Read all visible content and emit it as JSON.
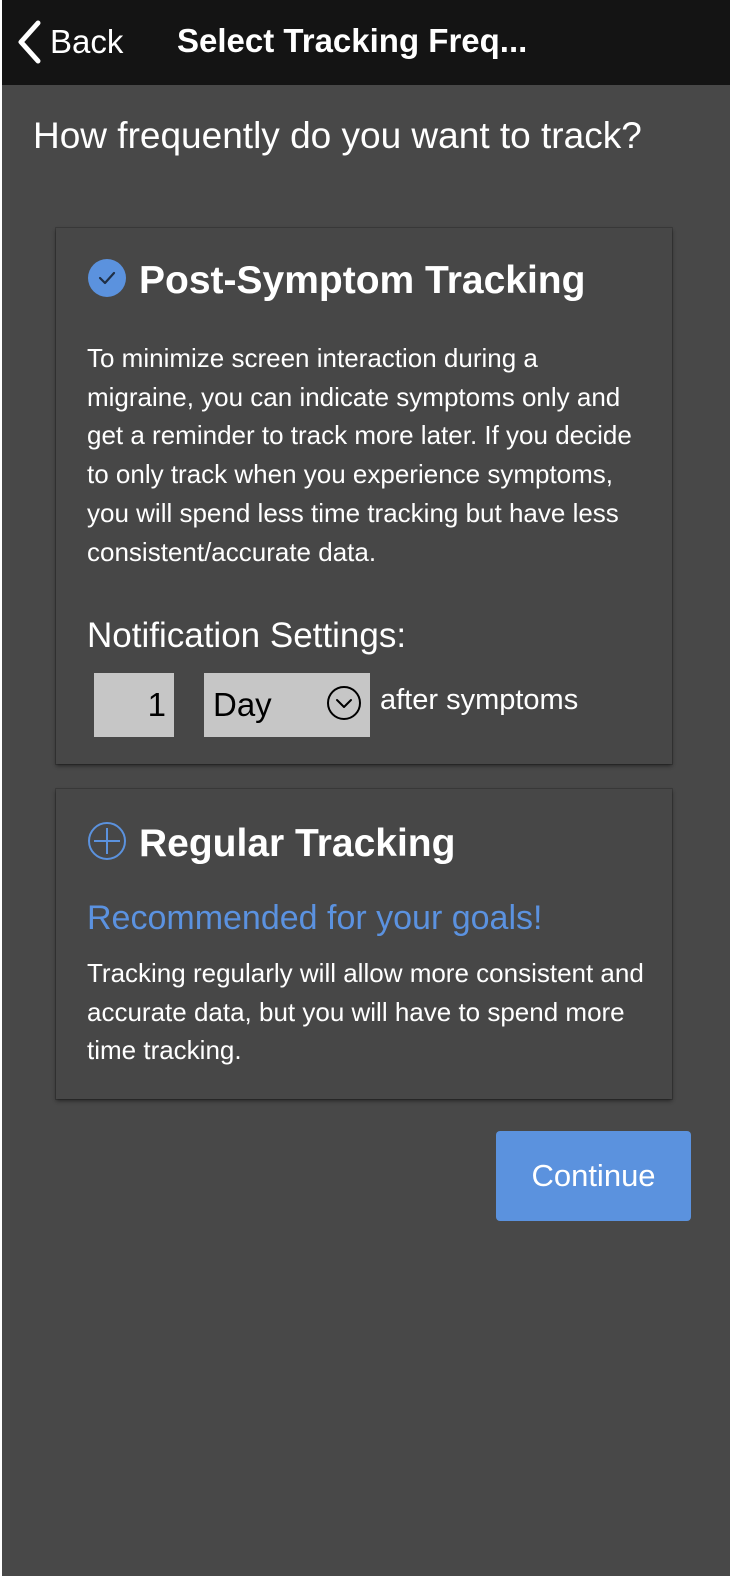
{
  "navbar": {
    "back_label": "Back",
    "title": "Select Tracking Freq..."
  },
  "question": "How frequently do you want to track?",
  "options": [
    {
      "title": "Post-Symptom Tracking",
      "selected": true,
      "icon": "check-circle-icon",
      "description": "To minimize screen interaction during a migraine, you can indicate symptoms only and get a reminder to track more later. If you decide to only track when you experience symptoms, you will spend less time tracking but have less consistent/accurate data.",
      "notification_label": "Notification Settings:",
      "notification_amount": "1",
      "notification_unit": "Day",
      "notification_suffix": "after symptoms"
    },
    {
      "title": "Regular Tracking",
      "selected": false,
      "icon": "plus-circle-icon",
      "recommendation": "Recommended for your goals!",
      "description": "Tracking regularly will allow more consistent and accurate data, but you will have to spend more time tracking."
    }
  ],
  "continue_label": "Continue",
  "colors": {
    "accent": "#5b92de",
    "background": "#484848",
    "navbar": "#141414",
    "input": "#c6c6c6"
  }
}
